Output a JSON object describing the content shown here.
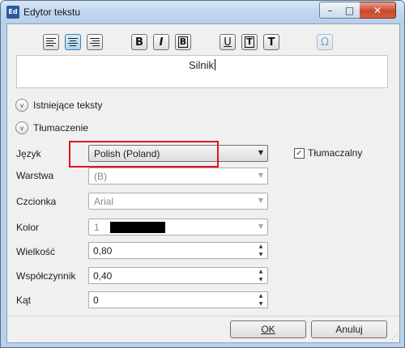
{
  "window": {
    "title": "Edytor tekstu",
    "app_icon_text": "Ed",
    "minimize_glyph": "–",
    "maximize_glyph": "□",
    "close_glyph": "✕"
  },
  "toolbar": {
    "bold_label": "B",
    "italic_label": "I",
    "bold_boxed_label": "B",
    "underline_label": "U",
    "overline_label": "T",
    "plain_label": "T",
    "special_char_label": "Ω"
  },
  "editor": {
    "text": "Silnik"
  },
  "sections": {
    "existing_texts": "Istniejące teksty",
    "translation": "Tłumaczenie",
    "expander_glyph": "∨"
  },
  "form": {
    "language_label": "Język",
    "language_value": "Polish (Poland)",
    "translatable_label": "Tłumaczalny",
    "translatable_checked": true,
    "layer_label": "Warstwa",
    "layer_value": "(B)",
    "font_label": "Czcionka",
    "font_value": "Arial",
    "color_label": "Kolor",
    "color_value": "1",
    "color_swatch": "#000000",
    "size_label": "Wielkość",
    "size_value": "0,80",
    "factor_label": "Współczynnik",
    "factor_value": "0,40",
    "angle_label": "Kąt",
    "angle_value": "0"
  },
  "buttons": {
    "ok": "OK",
    "cancel": "Anuluj"
  },
  "colors": {
    "highlight": "#e2141d",
    "close_button": "#c9492b"
  }
}
